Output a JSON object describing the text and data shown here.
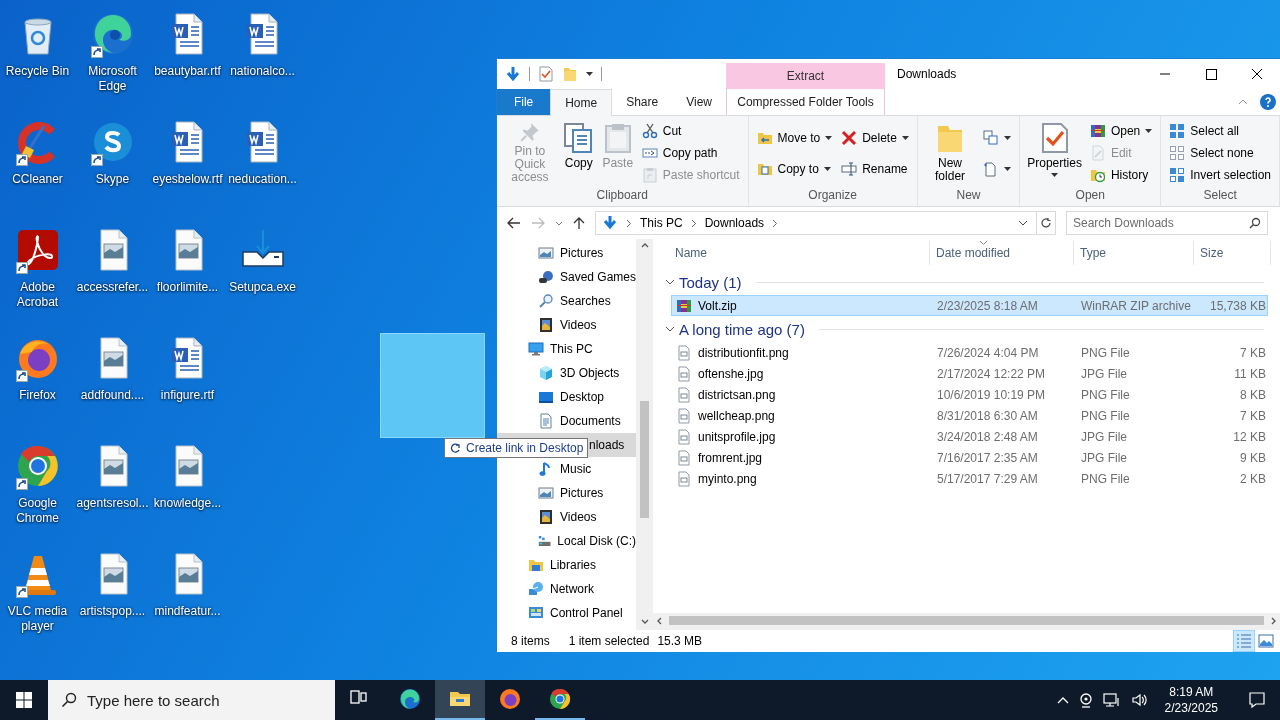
{
  "desktop": {
    "columns": [
      [
        {
          "label": "Recycle Bin",
          "kind": "recycle",
          "shortcut": false
        },
        {
          "label": "CCleaner",
          "kind": "ccleaner",
          "shortcut": true
        },
        {
          "label": "Adobe Acrobat",
          "kind": "acrobat",
          "shortcut": true
        },
        {
          "label": "Firefox",
          "kind": "firefox",
          "shortcut": true
        },
        {
          "label": "Google Chrome",
          "kind": "chrome",
          "shortcut": true
        },
        {
          "label": "VLC media player",
          "kind": "vlc",
          "shortcut": true
        }
      ],
      [
        {
          "label": "Microsoft Edge",
          "kind": "edge",
          "shortcut": true
        },
        {
          "label": "Skype",
          "kind": "skype",
          "shortcut": true
        },
        {
          "label": "accessrefer...",
          "kind": "image",
          "shortcut": false
        },
        {
          "label": "addfound....",
          "kind": "image",
          "shortcut": false
        },
        {
          "label": "agentsresol...",
          "kind": "image",
          "shortcut": false
        },
        {
          "label": "artistspop....",
          "kind": "image",
          "shortcut": false
        }
      ],
      [
        {
          "label": "beautybar.rtf",
          "kind": "word",
          "shortcut": false
        },
        {
          "label": "eyesbelow.rtf",
          "kind": "word",
          "shortcut": false
        },
        {
          "label": "floorlimite...",
          "kind": "image",
          "shortcut": false
        },
        {
          "label": "infigure.rtf",
          "kind": "word",
          "shortcut": false
        },
        {
          "label": "knowledge...",
          "kind": "image",
          "shortcut": false
        },
        {
          "label": "mindfeatur...",
          "kind": "image",
          "shortcut": false
        }
      ],
      [
        {
          "label": "nationalco...",
          "kind": "word",
          "shortcut": false
        },
        {
          "label": "neducation...",
          "kind": "word",
          "shortcut": false
        },
        {
          "label": "Setupca.exe",
          "kind": "setup",
          "shortcut": false
        }
      ]
    ]
  },
  "explorer": {
    "title": "Downloads",
    "context_tab": {
      "group": "Extract",
      "label": "Compressed Folder Tools",
      "selected": false
    },
    "tabs": [
      {
        "label": "File",
        "kind": "file",
        "selected": false
      },
      {
        "label": "Home",
        "kind": "tab",
        "selected": true
      },
      {
        "label": "Share",
        "kind": "tab",
        "selected": false
      },
      {
        "label": "View",
        "kind": "tab",
        "selected": false
      }
    ],
    "ribbon": [
      {
        "label": "Clipboard",
        "columns": [
          {
            "kind": "large",
            "items": [
              {
                "label": "Pin to Quick access",
                "kind": "pin",
                "disabled": true,
                "dropdown": false
              }
            ]
          },
          {
            "kind": "large",
            "items": [
              {
                "label": "Copy",
                "kind": "copy",
                "disabled": false,
                "dropdown": false
              }
            ]
          },
          {
            "kind": "large",
            "items": [
              {
                "label": "Paste",
                "kind": "paste",
                "disabled": true,
                "dropdown": false
              }
            ]
          },
          {
            "kind": "small",
            "items": [
              {
                "label": "Cut",
                "kind": "cut",
                "disabled": false,
                "dropdown": false
              },
              {
                "label": "Copy path",
                "kind": "copy-path",
                "disabled": false,
                "dropdown": false
              },
              {
                "label": "Paste shortcut",
                "kind": "paste-shortcut",
                "disabled": true,
                "dropdown": false
              }
            ]
          }
        ]
      },
      {
        "label": "Organize",
        "columns": [
          {
            "kind": "small",
            "items": [
              {
                "label": "Move to",
                "kind": "move-to",
                "disabled": false,
                "dropdown": true
              },
              {
                "label": "Copy to",
                "kind": "copy-to",
                "disabled": false,
                "dropdown": true
              }
            ]
          },
          {
            "kind": "small",
            "items": [
              {
                "label": "Delete",
                "kind": "delete",
                "disabled": false,
                "dropdown": true
              },
              {
                "label": "Rename",
                "kind": "rename",
                "disabled": false,
                "dropdown": false
              }
            ]
          }
        ]
      },
      {
        "label": "New",
        "columns": [
          {
            "kind": "large",
            "items": [
              {
                "label": "New folder",
                "kind": "new-folder",
                "disabled": false,
                "dropdown": false
              }
            ]
          },
          {
            "kind": "small",
            "items": [
              {
                "kind": "copy-folder",
                "disabled": false,
                "dropdown": true
              },
              {
                "kind": "new-item",
                "disabled": false,
                "dropdown": true
              }
            ]
          }
        ]
      },
      {
        "label": "Open",
        "columns": [
          {
            "kind": "large",
            "items": [
              {
                "label": "Properties",
                "kind": "properties",
                "disabled": false,
                "dropdown": true
              }
            ]
          },
          {
            "kind": "small",
            "items": [
              {
                "label": "Open",
                "kind": "open",
                "disabled": false,
                "dropdown": true
              },
              {
                "label": "Edit",
                "kind": "edit",
                "disabled": true,
                "dropdown": false
              },
              {
                "label": "History",
                "kind": "history",
                "disabled": false,
                "dropdown": false
              }
            ]
          }
        ]
      },
      {
        "label": "Select",
        "columns": [
          {
            "kind": "small",
            "items": [
              {
                "label": "Select all",
                "kind": "select-all",
                "disabled": false,
                "dropdown": false
              },
              {
                "label": "Select none",
                "kind": "select-none",
                "disabled": false,
                "dropdown": false
              },
              {
                "label": "Invert selection",
                "kind": "invert",
                "disabled": false,
                "dropdown": false
              }
            ]
          }
        ]
      }
    ],
    "address": {
      "path": [
        "This PC",
        "Downloads"
      ],
      "search_placeholder": "Search Downloads"
    },
    "nav_pane": {
      "continued": [
        {
          "label": "Pictures",
          "kind": "pictures",
          "selected": false
        },
        {
          "label": "Saved Games",
          "kind": "games",
          "selected": false
        },
        {
          "label": "Searches",
          "kind": "search",
          "selected": false
        },
        {
          "label": "Videos",
          "kind": "videos",
          "selected": false
        }
      ],
      "items": [
        {
          "label": "This PC",
          "kind": "pc",
          "selected": false,
          "children": [
            {
              "label": "3D Objects",
              "kind": "cube",
              "selected": false
            },
            {
              "label": "Desktop",
              "kind": "desktop",
              "selected": false
            },
            {
              "label": "Documents",
              "kind": "documents",
              "selected": false
            },
            {
              "label": "nloads",
              "kind": "covered",
              "selected": true
            },
            {
              "label": "Music",
              "kind": "music",
              "selected": false
            },
            {
              "label": "Pictures",
              "kind": "pictures",
              "selected": false
            },
            {
              "label": "Videos",
              "kind": "videos",
              "selected": false
            },
            {
              "label": "Local Disk (C:)",
              "kind": "disk",
              "selected": false
            }
          ]
        },
        {
          "label": "Libraries",
          "kind": "libraries",
          "selected": false
        },
        {
          "label": "Network",
          "kind": "network",
          "selected": false
        },
        {
          "label": "Control Panel",
          "kind": "control-panel",
          "selected": false
        }
      ]
    },
    "columns": [
      {
        "label": "Name",
        "sorted": false
      },
      {
        "label": "Date modified",
        "sorted": true
      },
      {
        "label": "Type",
        "sorted": false
      },
      {
        "label": "Size",
        "sorted": false
      }
    ],
    "groups": [
      {
        "label": "Today (1)",
        "expanded": true,
        "files": [
          {
            "name": "Volt.zip",
            "date": "2/23/2025 8:18 AM",
            "type": "WinRAR ZIP archive",
            "size": "15,738 KB",
            "kind": "zip",
            "selected": true
          }
        ]
      },
      {
        "label": "A long time ago (7)",
        "expanded": true,
        "files": [
          {
            "name": "distributionfit.png",
            "date": "7/26/2024 4:04 PM",
            "type": "PNG File",
            "size": "7 KB",
            "kind": "image",
            "selected": false
          },
          {
            "name": "oftenshe.jpg",
            "date": "2/17/2024 12:22 PM",
            "type": "JPG File",
            "size": "11 KB",
            "kind": "image",
            "selected": false
          },
          {
            "name": "districtsan.png",
            "date": "10/6/2019 10:19 PM",
            "type": "PNG File",
            "size": "8 KB",
            "kind": "image",
            "selected": false
          },
          {
            "name": "wellcheap.png",
            "date": "8/31/2018 6:30 AM",
            "type": "PNG File",
            "size": "7 KB",
            "kind": "image",
            "selected": false
          },
          {
            "name": "unitsprofile.jpg",
            "date": "3/24/2018 2:48 AM",
            "type": "JPG File",
            "size": "12 KB",
            "kind": "image",
            "selected": false
          },
          {
            "name": "fromrent.jpg",
            "date": "7/16/2017 2:35 AM",
            "type": "JPG File",
            "size": "9 KB",
            "kind": "image",
            "selected": false
          },
          {
            "name": "myinto.png",
            "date": "5/17/2017 7:29 AM",
            "type": "PNG File",
            "size": "2 KB",
            "kind": "image",
            "selected": false
          }
        ]
      }
    ],
    "status": {
      "count": "8 items",
      "selection": "1 item selected",
      "size": "15.3 MB"
    },
    "views": [
      {
        "kind": "details",
        "selected": true
      },
      {
        "kind": "large-icons",
        "selected": false
      }
    ]
  },
  "drag": {
    "tooltip": "Create link in Desktop"
  },
  "taskbar": {
    "search_placeholder": "Type here to search",
    "apps": [
      {
        "kind": "taskview",
        "running": false,
        "active": false
      },
      {
        "kind": "edge",
        "running": false,
        "active": false
      },
      {
        "kind": "explorer",
        "running": true,
        "active": true
      },
      {
        "kind": "firefox",
        "running": false,
        "active": false
      },
      {
        "kind": "chrome",
        "running": true,
        "active": false
      }
    ],
    "clock": {
      "time": "8:19 AM",
      "date": "2/23/2025"
    }
  }
}
